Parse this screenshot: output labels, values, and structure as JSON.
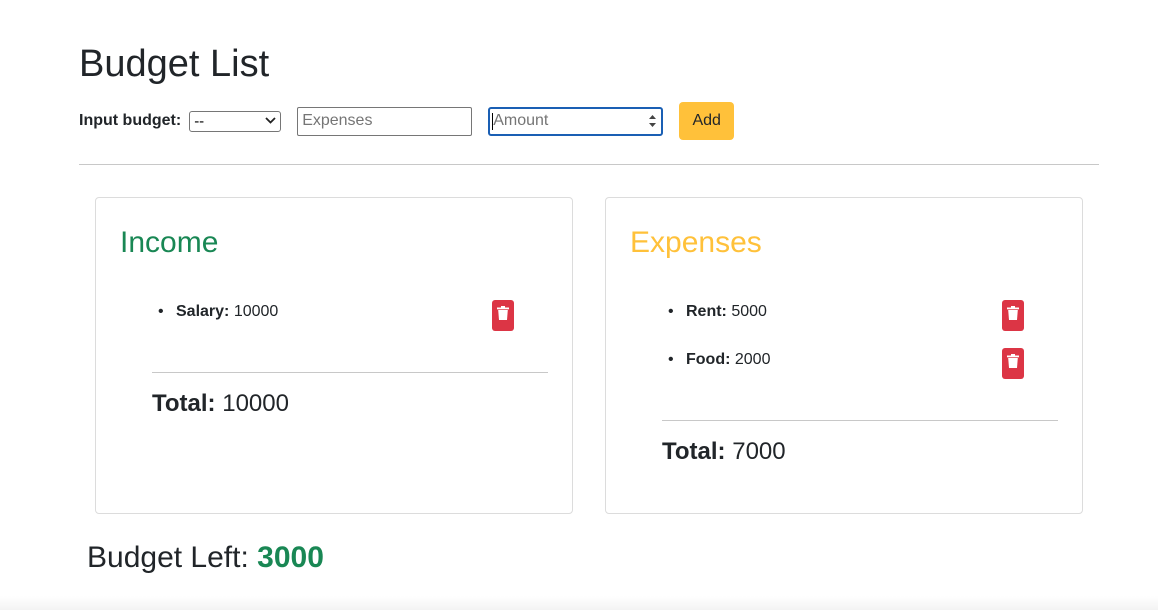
{
  "page_title": "Budget List",
  "input_form": {
    "label": "Input budget:",
    "type_select_value": "--",
    "expenses_placeholder": "Expenses",
    "amount_placeholder": "Amount",
    "add_label": "Add"
  },
  "income": {
    "title": "Income",
    "items": [
      {
        "name": "Salary:",
        "amount": "10000"
      }
    ],
    "total_label": "Total:",
    "total_value": "10000"
  },
  "expenses": {
    "title": "Expenses",
    "items": [
      {
        "name": "Rent:",
        "amount": "5000"
      },
      {
        "name": "Food:",
        "amount": "2000"
      }
    ],
    "total_label": "Total:",
    "total_value": "7000"
  },
  "budget_left": {
    "label": "Budget Left:",
    "value": "3000"
  },
  "colors": {
    "income_title": "#198754",
    "expenses_title": "#ffc13a",
    "add_button": "#ffc13a",
    "delete_button": "#dc3545",
    "budget_value": "#198754"
  },
  "icons": {
    "delete": "trash-icon",
    "select_chevron": "chevron-down-icon",
    "spinner": "spinner-arrows-icon"
  }
}
